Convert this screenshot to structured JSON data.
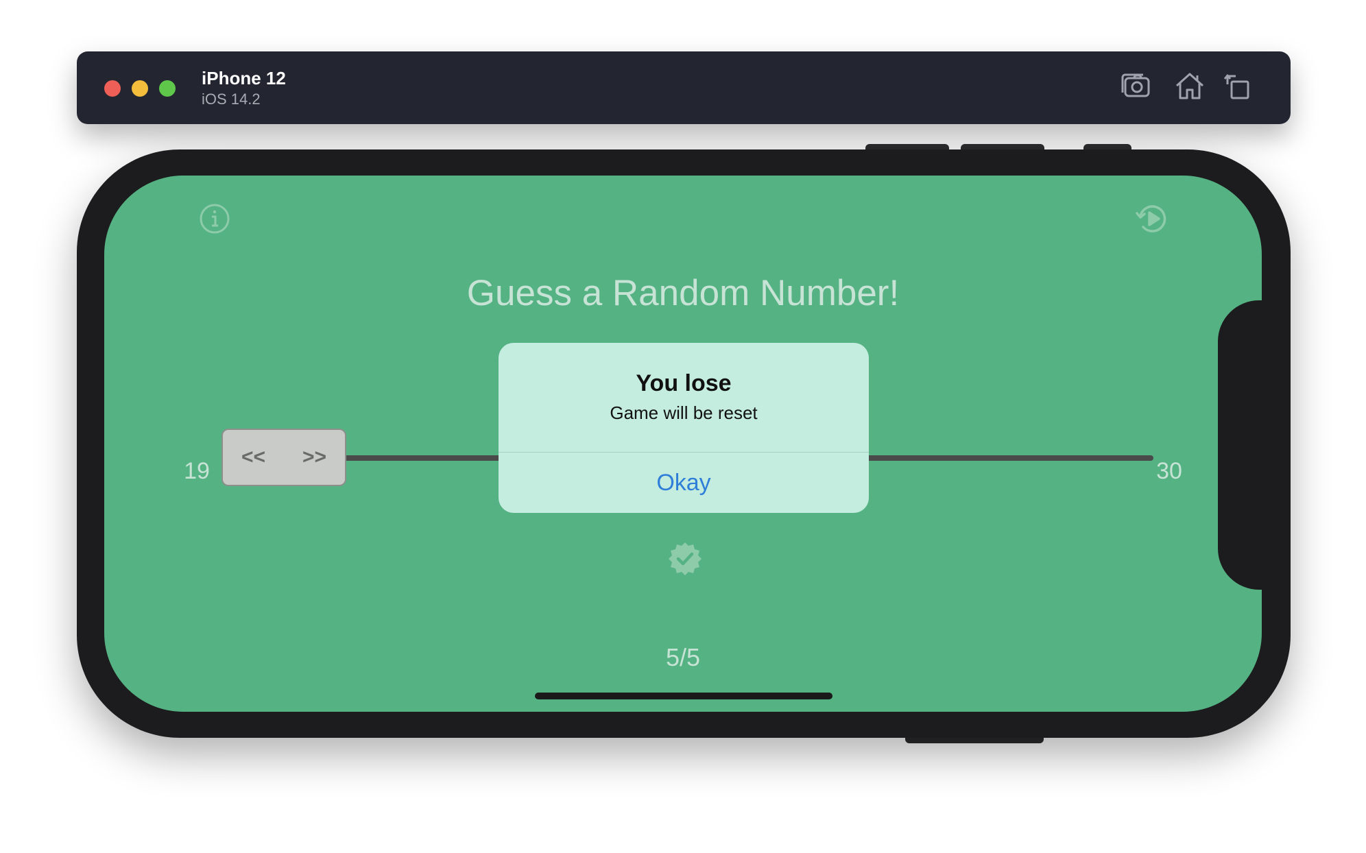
{
  "simulator": {
    "device_name": "iPhone 12",
    "os_version": "iOS 14.2",
    "toolbar_icons": [
      "screenshot-icon",
      "home-icon",
      "rotate-icon"
    ]
  },
  "app": {
    "title": "Guess a Random Number!",
    "range_min": "19",
    "range_max": "30",
    "slider_left_label": "<<",
    "slider_right_label": ">>",
    "score": "5/5",
    "background_color": "#55b283",
    "icons": [
      "info-icon",
      "restart-icon",
      "check-badge-icon"
    ]
  },
  "alert": {
    "title": "You lose",
    "message": "Game will be reset",
    "button_label": "Okay",
    "background_color": "#c4ede0",
    "button_color": "#2f7fd8"
  }
}
